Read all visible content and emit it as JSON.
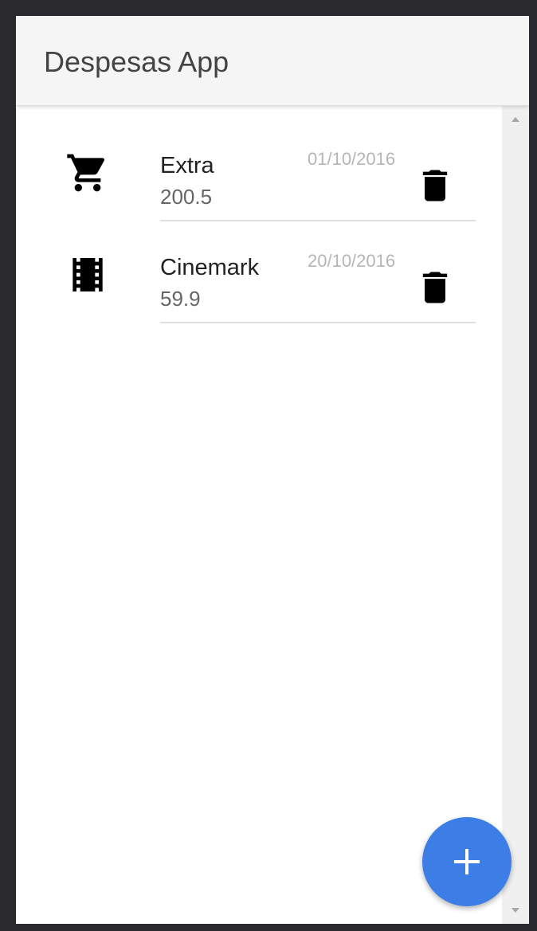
{
  "app_bar": {
    "title": "Despesas App"
  },
  "expenses": [
    {
      "name": "Extra",
      "amount": "200.5",
      "date": "01/10/2016",
      "category_icon": "shopping-cart-icon",
      "delete_icon": "trash-icon"
    },
    {
      "name": "Cinemark",
      "amount": "59.9",
      "date": "20/10/2016",
      "category_icon": "film-icon",
      "delete_icon": "trash-icon"
    }
  ],
  "fab": {
    "icon": "plus-icon",
    "color": "#3d7ee6"
  },
  "colors": {
    "app_bar_background": "#f5f5f5",
    "title_text": "#444444",
    "date_text": "#b5b5b5",
    "accent": "#3d7ee6"
  }
}
